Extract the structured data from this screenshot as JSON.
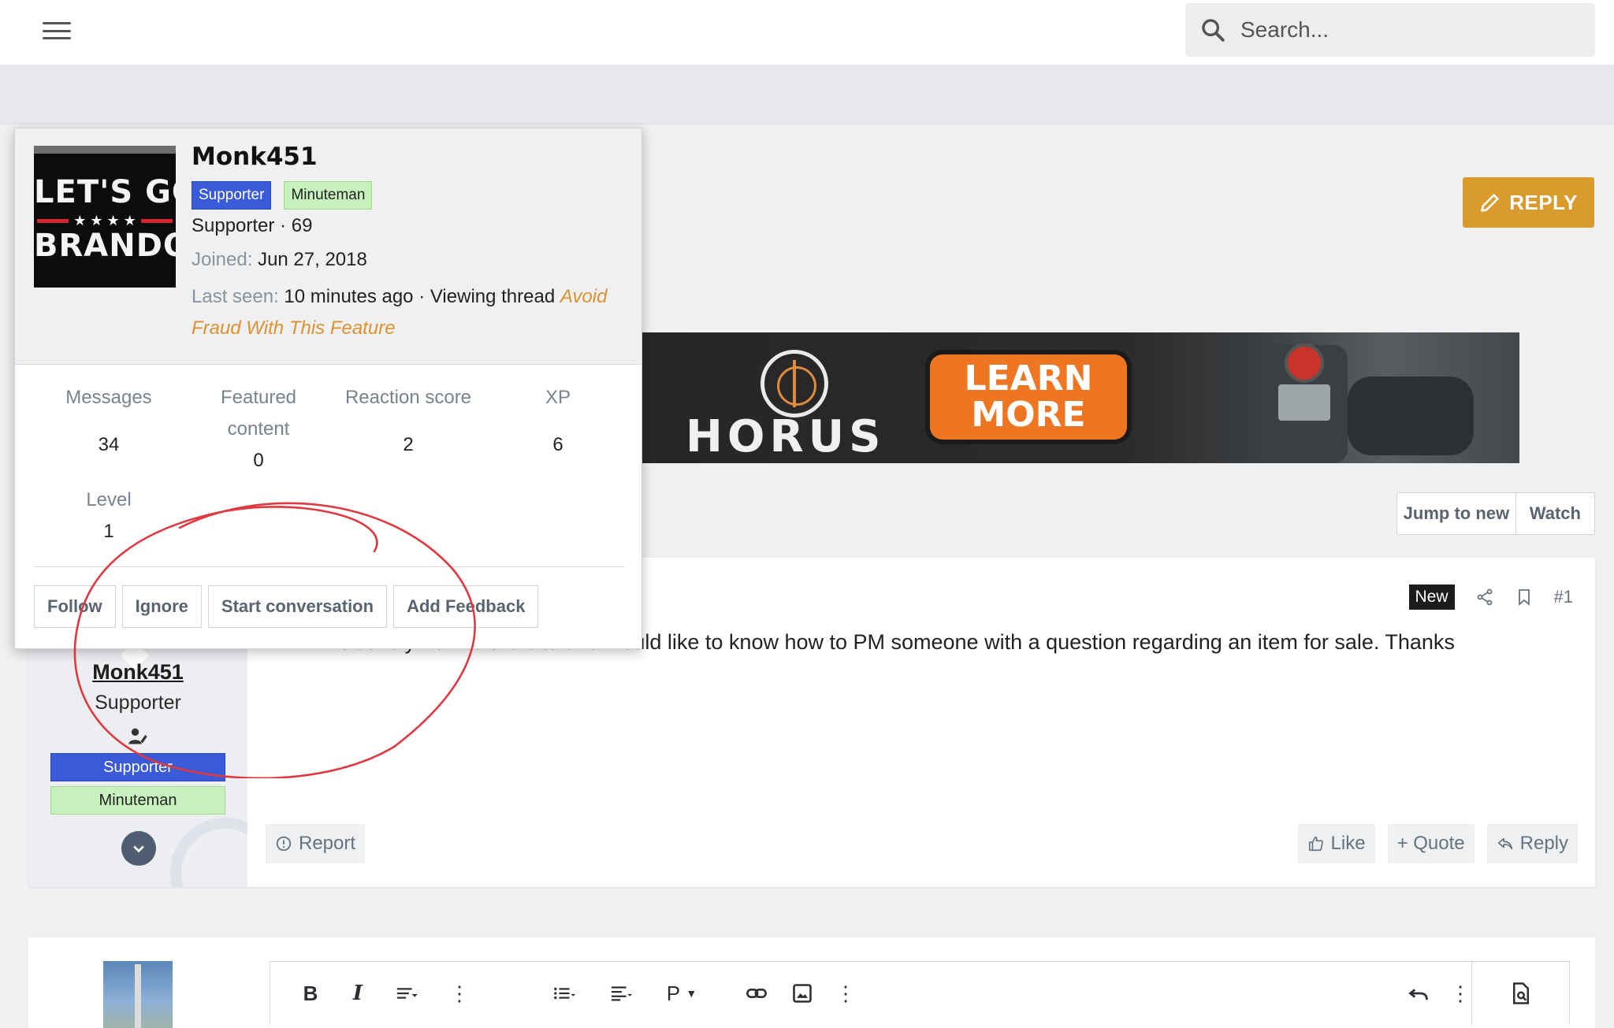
{
  "search": {
    "placeholder": "Search..."
  },
  "reply_button": {
    "label": "REPLY"
  },
  "ad": {
    "brand": "HORUS",
    "cta_line1": "LEARN",
    "cta_line2": "MORE"
  },
  "thread_buttons": [
    {
      "label": "Jump to new"
    },
    {
      "label": "Watch"
    }
  ],
  "popup": {
    "avatar_text": {
      "line1": "LET'S GO",
      "line2": "★ ★ ★ ★",
      "line3": "BRANDON"
    },
    "username": "Monk451",
    "banners": [
      "Supporter",
      "Minuteman"
    ],
    "title_line": "Supporter · 69",
    "joined_label": "Joined:",
    "joined_value": "Jun 27, 2018",
    "last_seen_label": "Last seen:",
    "last_seen_value": "10 minutes ago · Viewing thread",
    "thread_link_part1": "Avoid",
    "thread_link_part2": "Fraud With This Feature",
    "stats": [
      {
        "label": "Messages",
        "value": "34"
      },
      {
        "label_line1": "Featured",
        "label_line2": "content",
        "value": "0"
      },
      {
        "label": "Reaction score",
        "value": "2"
      },
      {
        "label": "XP",
        "value": "6"
      },
      {
        "label": "Level",
        "value": "1"
      }
    ],
    "actions": [
      "Follow",
      "Ignore",
      "Start conversation",
      "Add Feedback"
    ]
  },
  "post": {
    "username": "Monk451",
    "user_title": "Supporter",
    "banners": [
      "Supporter",
      "Minuteman"
    ],
    "new_badge": "New",
    "post_number": "#1",
    "body": "I'm relatively new to the site and would like to know how to PM someone with a question regarding an item for sale. Thanks",
    "report": "Report",
    "actions": [
      "Like",
      "+ Quote",
      "Reply"
    ]
  },
  "editor": {
    "heading_tool": "P"
  },
  "colors": {
    "accent": "#d99a2e",
    "supporter": "#3a5bd9",
    "minuteman": "#c8f2bd",
    "annotation": "#e0383f",
    "link": "#dd9130"
  }
}
